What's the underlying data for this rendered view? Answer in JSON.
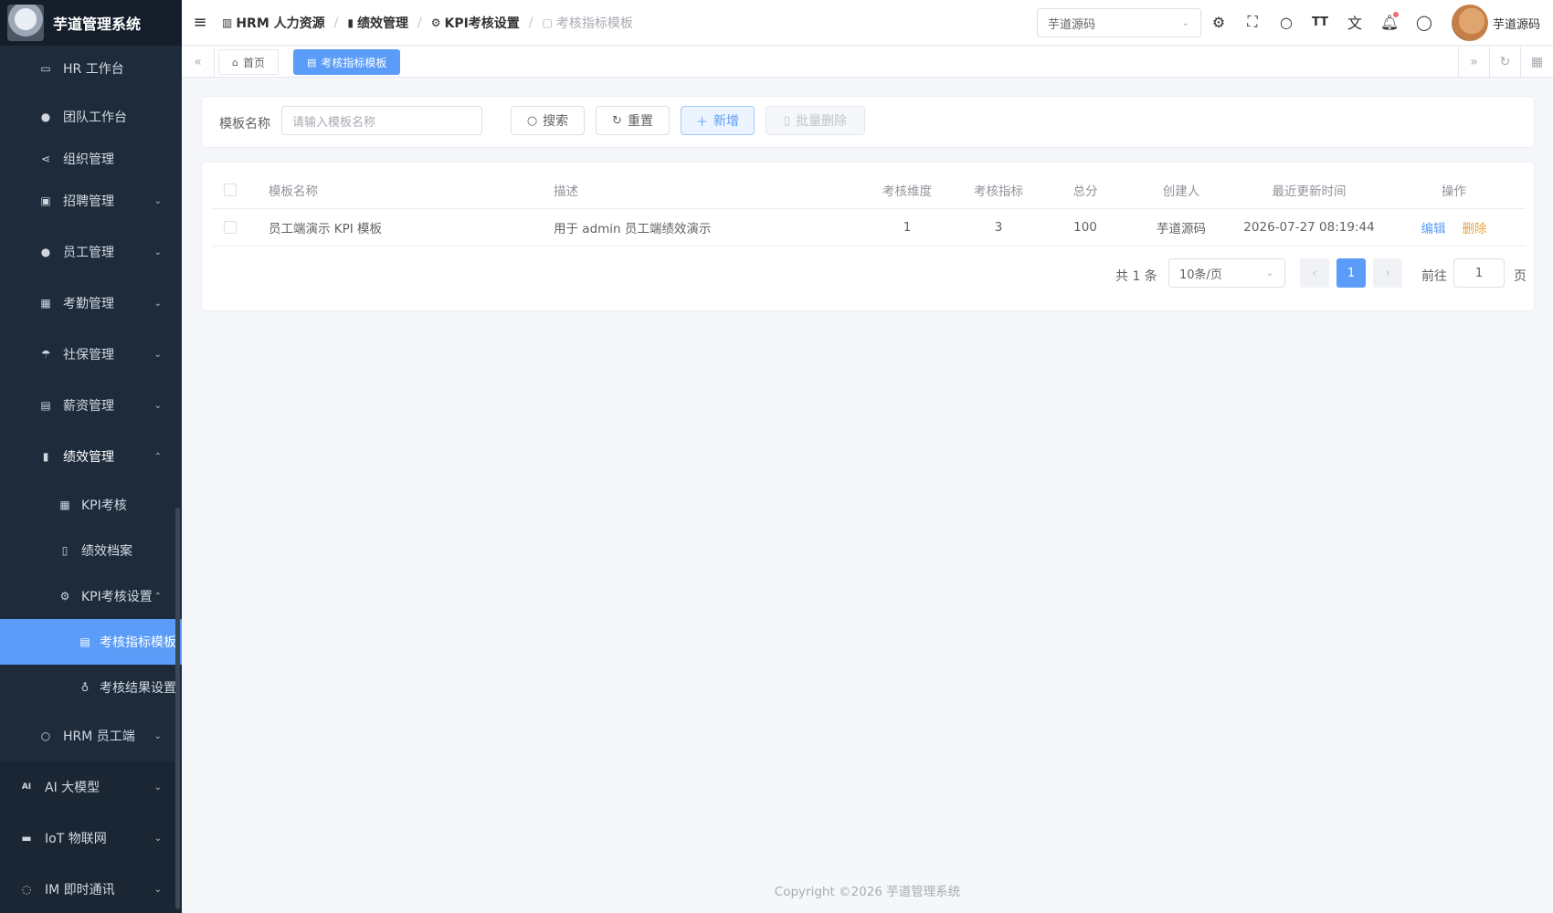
{
  "app": {
    "title": "芋道管理系统"
  },
  "sidebar": {
    "items": [
      {
        "label": "HR 工作台",
        "icon": "monitor-icon"
      },
      {
        "label": "团队工作台",
        "icon": "user-icon"
      },
      {
        "label": "组织管理",
        "icon": "share-icon"
      },
      {
        "label": "招聘管理",
        "icon": "briefcase-icon"
      },
      {
        "label": "员工管理",
        "icon": "user-icon"
      },
      {
        "label": "考勤管理",
        "icon": "calendar-icon"
      },
      {
        "label": "社保管理",
        "icon": "umbrella-icon"
      },
      {
        "label": "薪资管理",
        "icon": "money-icon"
      },
      {
        "label": "绩效管理",
        "icon": "bar-chart-icon"
      },
      {
        "label": "KPI考核",
        "icon": "calendar-icon"
      },
      {
        "label": "绩效档案",
        "icon": "document-icon"
      },
      {
        "label": "KPI考核设置",
        "icon": "gear-icon"
      },
      {
        "label": "考核指标模板",
        "icon": "file-icon"
      },
      {
        "label": "考核结果设置",
        "icon": "medal-icon"
      },
      {
        "label": "HRM 员工端",
        "icon": "user-outline-icon"
      },
      {
        "label": "AI 大模型",
        "icon": "ai-icon"
      },
      {
        "label": "IoT 物联网",
        "icon": "iot-icon"
      },
      {
        "label": "IM 即时通讯",
        "icon": "chat-icon"
      }
    ]
  },
  "header": {
    "breadcrumb": [
      "HRM 人力资源",
      "绩效管理",
      "KPI考核设置",
      "考核指标模板"
    ],
    "tenant": "芋道源码",
    "user_name": "芋道源码"
  },
  "tabs": {
    "home": "首页",
    "current": "考核指标模板"
  },
  "search": {
    "label": "模板名称",
    "placeholder": "请输入模板名称",
    "search_btn": "搜索",
    "reset_btn": "重置",
    "add_btn": "新增",
    "batch_delete_btn": "批量删除"
  },
  "table": {
    "headers": [
      "模板名称",
      "描述",
      "考核维度",
      "考核指标",
      "总分",
      "创建人",
      "最近更新时间",
      "操作"
    ],
    "rows": [
      {
        "name": "员工端演示 KPI 模板",
        "desc": "用于 admin 员工端绩效演示",
        "dimensions": "1",
        "indicators": "3",
        "total": "100",
        "creator": "芋道源码",
        "updated": "2026-07-27 08:19:44",
        "edit": "编辑",
        "delete": "删除"
      }
    ]
  },
  "pagination": {
    "total": "共 1 条",
    "page_size": "10条/页",
    "current_page": "1",
    "goto": "前往",
    "goto_value": "1",
    "page_suffix": "页"
  },
  "footer": {
    "copyright": "Copyright ©2026 芋道管理系统"
  },
  "colors": {
    "primary": "#5a9cf8",
    "sidebar_bg": "#1d2b3a",
    "danger_link": "#e6a23c"
  }
}
